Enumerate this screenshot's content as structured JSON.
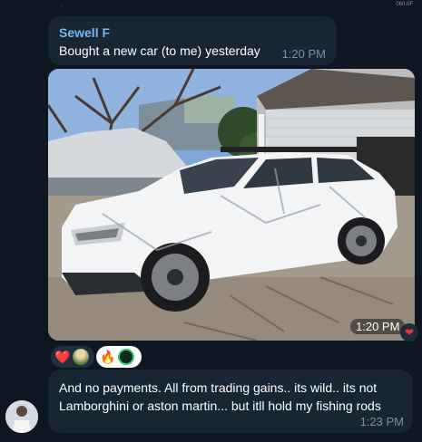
{
  "status": {
    "top_right": "060.0F"
  },
  "messages": [
    {
      "sender": "Sewell F",
      "text": "Bought a new car (to me) yesterday",
      "time": "1:20 PM"
    },
    {
      "type": "photo",
      "time": "1:20 PM",
      "reaction_icon": "heart-icon"
    },
    {
      "text": "And no payments. All from trading gains.. its wild.. its not Lamborghini or aston martin... but itll hold my fishing rods",
      "time": "1:23 PM"
    }
  ],
  "reactions": [
    {
      "emoji": "❤️",
      "icon": "heart-icon"
    },
    {
      "emoji": "🔥",
      "icon": "fire-icon"
    }
  ],
  "colors": {
    "background": "#0e1621",
    "bubble": "#182533",
    "sender": "#7ab8ec",
    "timestamp": "#7f8ea0"
  }
}
